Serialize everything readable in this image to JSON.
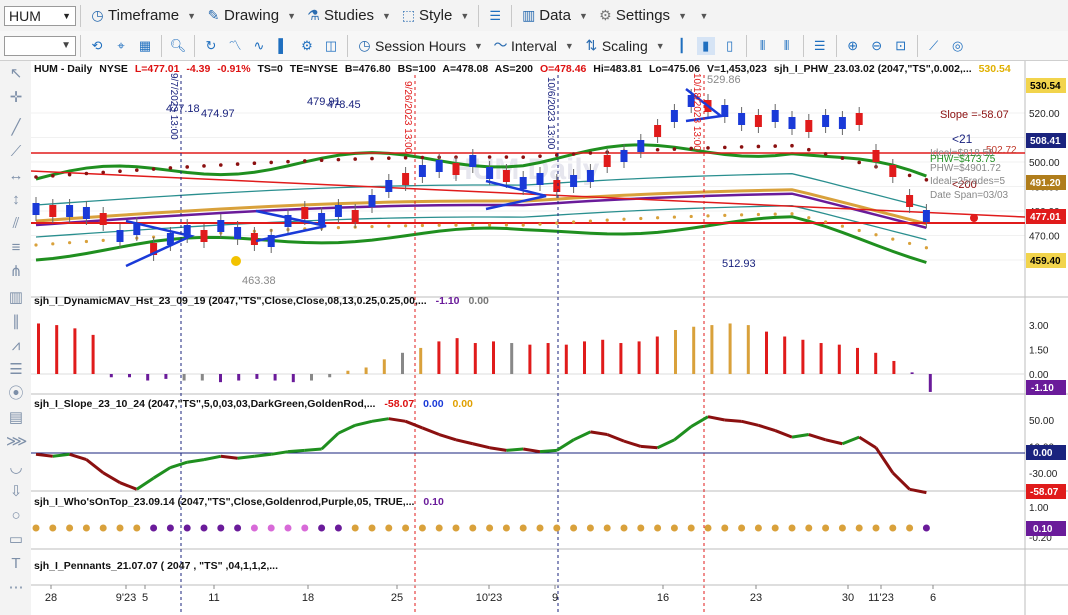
{
  "toolbar": {
    "symbol": "HUM",
    "menus": [
      {
        "label": "Timeframe",
        "icon": "clock-icon"
      },
      {
        "label": "Drawing",
        "icon": "pencil-icon"
      },
      {
        "label": "Studies",
        "icon": "studies-icon"
      },
      {
        "label": "Style",
        "icon": "style-icon"
      },
      {
        "label": "Data",
        "icon": "data-icon"
      },
      {
        "label": "Settings",
        "icon": "gear-icon"
      }
    ],
    "row2_menus": [
      {
        "label": "Session Hours"
      },
      {
        "label": "Interval"
      },
      {
        "label": "Scaling"
      }
    ]
  },
  "header": {
    "symbol": "HUM",
    "interval": "Daily",
    "exchange": "NYSE",
    "last": "L=477.01",
    "change": "-4.39",
    "pct": "-0.91%",
    "ts": "TS=0",
    "te": "TE=NYSE",
    "bid": "B=476.80",
    "bs": "BS=100",
    "ask": "A=478.08",
    "as": "AS=200",
    "open": "O=478.46",
    "high": "Hi=483.81",
    "low": "Lo=475.06",
    "volume": "V=1,453,023",
    "study": "sjh_I_PHW_23.03.02 (2047,\"TS\",0.002,...",
    "study_value": "530.54",
    "watermark": "HUM Daily"
  },
  "price_pane": {
    "axis_ticks": [
      "520.00",
      "510.00",
      "500.00",
      "490.00",
      "480.00",
      "470.00",
      "460.00"
    ],
    "badges": [
      {
        "text": "530.54",
        "color": "#f2d44c",
        "tcolor": "#000"
      },
      {
        "text": "508.41",
        "color": "#1a237e",
        "tcolor": "#fff"
      },
      {
        "text": "491.20",
        "color": "#b07d1b",
        "tcolor": "#fff"
      },
      {
        "text": "477.01",
        "color": "#e01b1b",
        "tcolor": "#fff"
      },
      {
        "text": "459.40",
        "color": "#f2d44c",
        "tcolor": "#000"
      }
    ],
    "annotations": {
      "slope": "Slope =-58.07",
      "lt21": "<21",
      "lt200": "<200",
      "v502": "502.72",
      "ideal1": "Ideal=$818.56",
      "phw1": "PHW=$473.75",
      "phw2": "PHW=$4901.72",
      "ideal2": "Ideal=25rades=5",
      "datespan": "Date Span=03/03",
      "p529": "529.86",
      "p477": "477.18",
      "p474": "474.97",
      "p479": "479.91",
      "p478": "478.45",
      "p463": "463.38",
      "p512": "512.93"
    },
    "vline_labels": [
      "9/7/2023 13:00",
      "9/26/2023 13:00",
      "10/6/2023 13:00",
      "10/18/2023 13:00"
    ]
  },
  "mav_pane": {
    "title": "sjh_I_DynamicMAV_Hst_23_09_19 (2047,\"TS\",Close,Close,08,13,0.25,0.25,00,...",
    "v1": "-1.10",
    "v2": "0.00",
    "ticks": [
      "3.00",
      "1.50",
      "0.00"
    ],
    "badge": "-1.10",
    "bars": [
      3.1,
      3.0,
      2.8,
      2.4,
      -0.2,
      -0.2,
      -0.4,
      -0.3,
      -0.4,
      -0.4,
      -0.5,
      -0.4,
      -0.3,
      -0.4,
      -0.5,
      -0.4,
      -0.2,
      0.2,
      0.4,
      0.9,
      1.3,
      1.6,
      2.0,
      2.2,
      1.9,
      2.0,
      1.9,
      1.8,
      1.9,
      1.8,
      2.0,
      2.1,
      1.9,
      2.0,
      2.3,
      2.7,
      2.9,
      3.0,
      3.1,
      3.0,
      2.6,
      2.3,
      2.1,
      1.9,
      1.8,
      1.6,
      1.3,
      0.8,
      0.1,
      -1.1
    ],
    "bar_colors": [
      "r",
      "r",
      "r",
      "r",
      "p",
      "p",
      "p",
      "p",
      "g",
      "g",
      "p",
      "p",
      "p",
      "p",
      "p",
      "g",
      "g",
      "o",
      "o",
      "o",
      "g",
      "o",
      "r",
      "r",
      "r",
      "r",
      "g",
      "r",
      "r",
      "r",
      "r",
      "r",
      "r",
      "r",
      "r",
      "o",
      "o",
      "o",
      "o",
      "o",
      "r",
      "r",
      "r",
      "r",
      "r",
      "r",
      "r",
      "r",
      "p",
      "p"
    ]
  },
  "slope_pane": {
    "title": "sjh_I_Slope_23_10_24 (2047,\"TS\",5,0,03,03,DarkGreen,GoldenRod,...",
    "v1": "-58.07",
    "v2": "0.00",
    "v3": "0.00",
    "ticks": [
      "50.00",
      "10.00",
      "-30.00"
    ],
    "badge_zero": "0.00",
    "badge_val": "-58.07",
    "values": [
      -2,
      -5,
      -2,
      -10,
      -30,
      -45,
      -55,
      -38,
      -22,
      -14,
      -10,
      -5,
      -8,
      -5,
      -2,
      2,
      4,
      6,
      30,
      42,
      48,
      52,
      48,
      38,
      28,
      20,
      14,
      8,
      4,
      6,
      2,
      4,
      20,
      32,
      28,
      18,
      10,
      8,
      20,
      40,
      55,
      50,
      48,
      42,
      34,
      24,
      28,
      20,
      14,
      24,
      8,
      -30,
      -55,
      -60
    ],
    "up": [
      false,
      false,
      true,
      false,
      false,
      false,
      false,
      true,
      true,
      true,
      true,
      true,
      false,
      true,
      true,
      true,
      true,
      true,
      true,
      true,
      true,
      true,
      false,
      false,
      false,
      false,
      false,
      false,
      false,
      true,
      false,
      true,
      true,
      true,
      false,
      false,
      false,
      false,
      true,
      true,
      true,
      false,
      false,
      false,
      false,
      false,
      true,
      false,
      false,
      true,
      false,
      false,
      false,
      false
    ]
  },
  "whos_pane": {
    "title": "sjh_I_Who'sOnTop_23.09.14 (2047,\"TS\",Close,Goldenrod,Purple,05,  TRUE,...",
    "v1": "0.10",
    "ticks": [
      "1.00",
      "-0.20"
    ],
    "badge": "0.10"
  },
  "pennants_pane": {
    "title": "sjh_I_Pennants_21.07.07 (  2047 ,  \"TS\" ,04,1,1,2,..."
  },
  "time_axis": {
    "labels": [
      "28",
      "9'23",
      "5",
      "11",
      "18",
      "25",
      "10'23",
      "9",
      "16",
      "23",
      "30",
      "11'23",
      "6"
    ]
  },
  "colors": {
    "up_candle": "#1a3ad8",
    "down_candle": "#e01b1b",
    "green_band": "#1f8f1f",
    "gold_band": "#d9a13b",
    "purple_band": "#6a1b9a",
    "teal_band": "#2a8f8f",
    "slope_up": "#1f8f1f",
    "slope_down": "#8b1010"
  }
}
